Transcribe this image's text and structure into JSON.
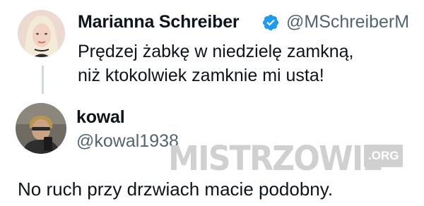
{
  "tweet_original": {
    "display_name": "Marianna Schreiber",
    "handle": "@MSchreiberM",
    "verified": true,
    "text_line1": "Prędzej żabkę w niedzielę zamkną,",
    "text_line2": "niż ktokolwiek zamknie mi usta!"
  },
  "tweet_reply": {
    "display_name": "kowal",
    "handle": "@kowal1938",
    "text": "No ruch przy drzwiach macie podobny."
  },
  "watermark": {
    "text": "MISTRZOWIE",
    "suffix": ".ORG"
  },
  "colors": {
    "verified_blue": "#1d9bf0",
    "handle_gray": "#536471",
    "thread_line": "#cfd9de"
  }
}
